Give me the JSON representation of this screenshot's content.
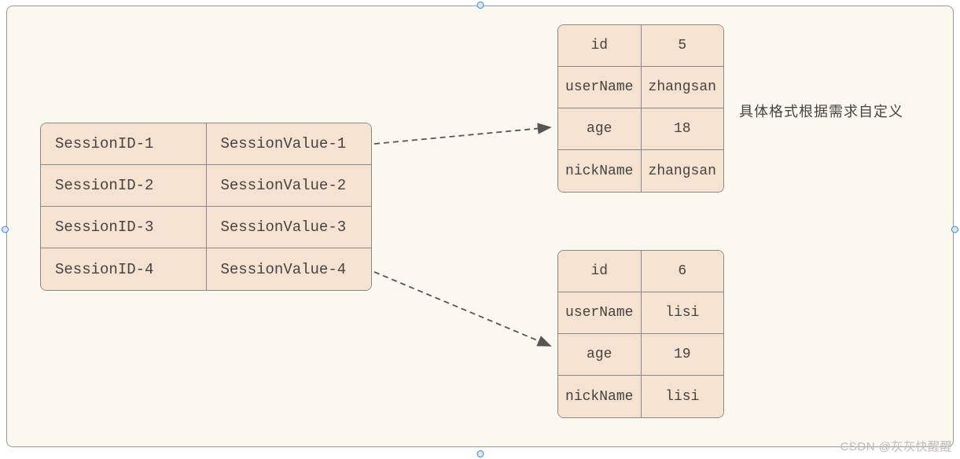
{
  "sessionTable": {
    "rows": [
      {
        "id": "SessionID-1",
        "value": "SessionValue-1"
      },
      {
        "id": "SessionID-2",
        "value": "SessionValue-2"
      },
      {
        "id": "SessionID-3",
        "value": "SessionValue-3"
      },
      {
        "id": "SessionID-4",
        "value": "SessionValue-4"
      }
    ]
  },
  "detailTables": [
    {
      "rows": [
        {
          "key": "id",
          "val": "5"
        },
        {
          "key": "userName",
          "val": "zhangsan"
        },
        {
          "key": "age",
          "val": "18"
        },
        {
          "key": "nickName",
          "val": "zhangsan"
        }
      ]
    },
    {
      "rows": [
        {
          "key": "id",
          "val": "6"
        },
        {
          "key": "userName",
          "val": "lisi"
        },
        {
          "key": "age",
          "val": "19"
        },
        {
          "key": "nickName",
          "val": "lisi"
        }
      ]
    }
  ],
  "note": "具体格式根据需求自定义",
  "watermark": "CSDN @灰灰快醒醒"
}
